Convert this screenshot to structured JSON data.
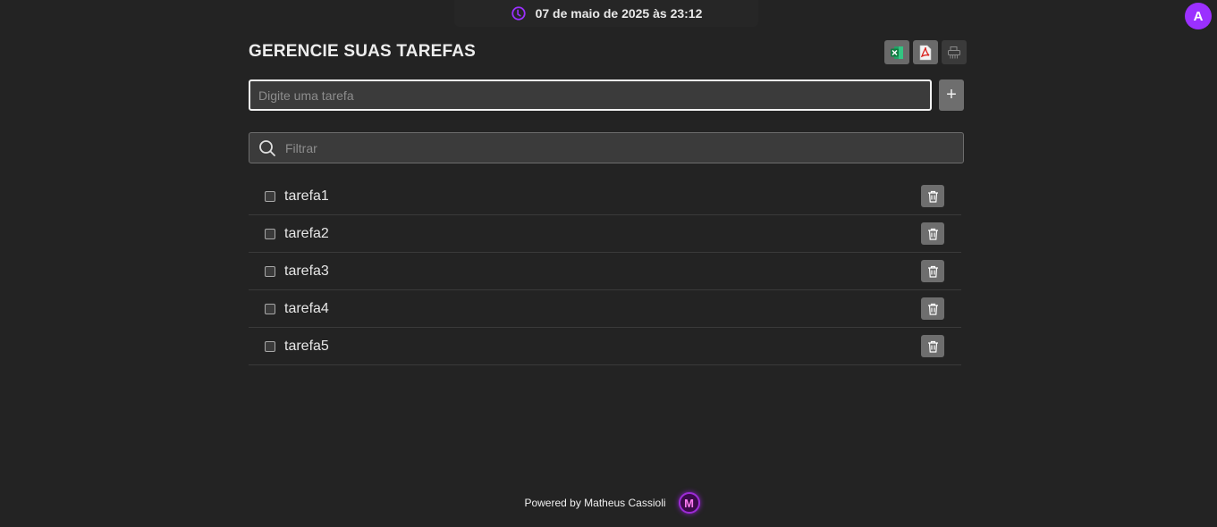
{
  "header": {
    "datetime": "07 de maio de 2025 às 23:12",
    "avatar_letter": "A"
  },
  "main": {
    "title": "GERENCIE SUAS TAREFAS",
    "task_input_placeholder": "Digite uma tarefa",
    "add_label": "+",
    "filter_placeholder": "Filtrar",
    "export_icons": [
      "excel-icon",
      "pdf-icon",
      "print-icon"
    ]
  },
  "tasks": [
    {
      "label": "tarefa1",
      "checked": false
    },
    {
      "label": "tarefa2",
      "checked": false
    },
    {
      "label": "tarefa3",
      "checked": false
    },
    {
      "label": "tarefa4",
      "checked": false
    },
    {
      "label": "tarefa5",
      "checked": false
    }
  ],
  "footer": {
    "text": "Powered by Matheus Cassioli",
    "logo_letter": "M"
  },
  "colors": {
    "background": "#232323",
    "accent": "#9b30ff",
    "button": "#6e6e6e"
  }
}
